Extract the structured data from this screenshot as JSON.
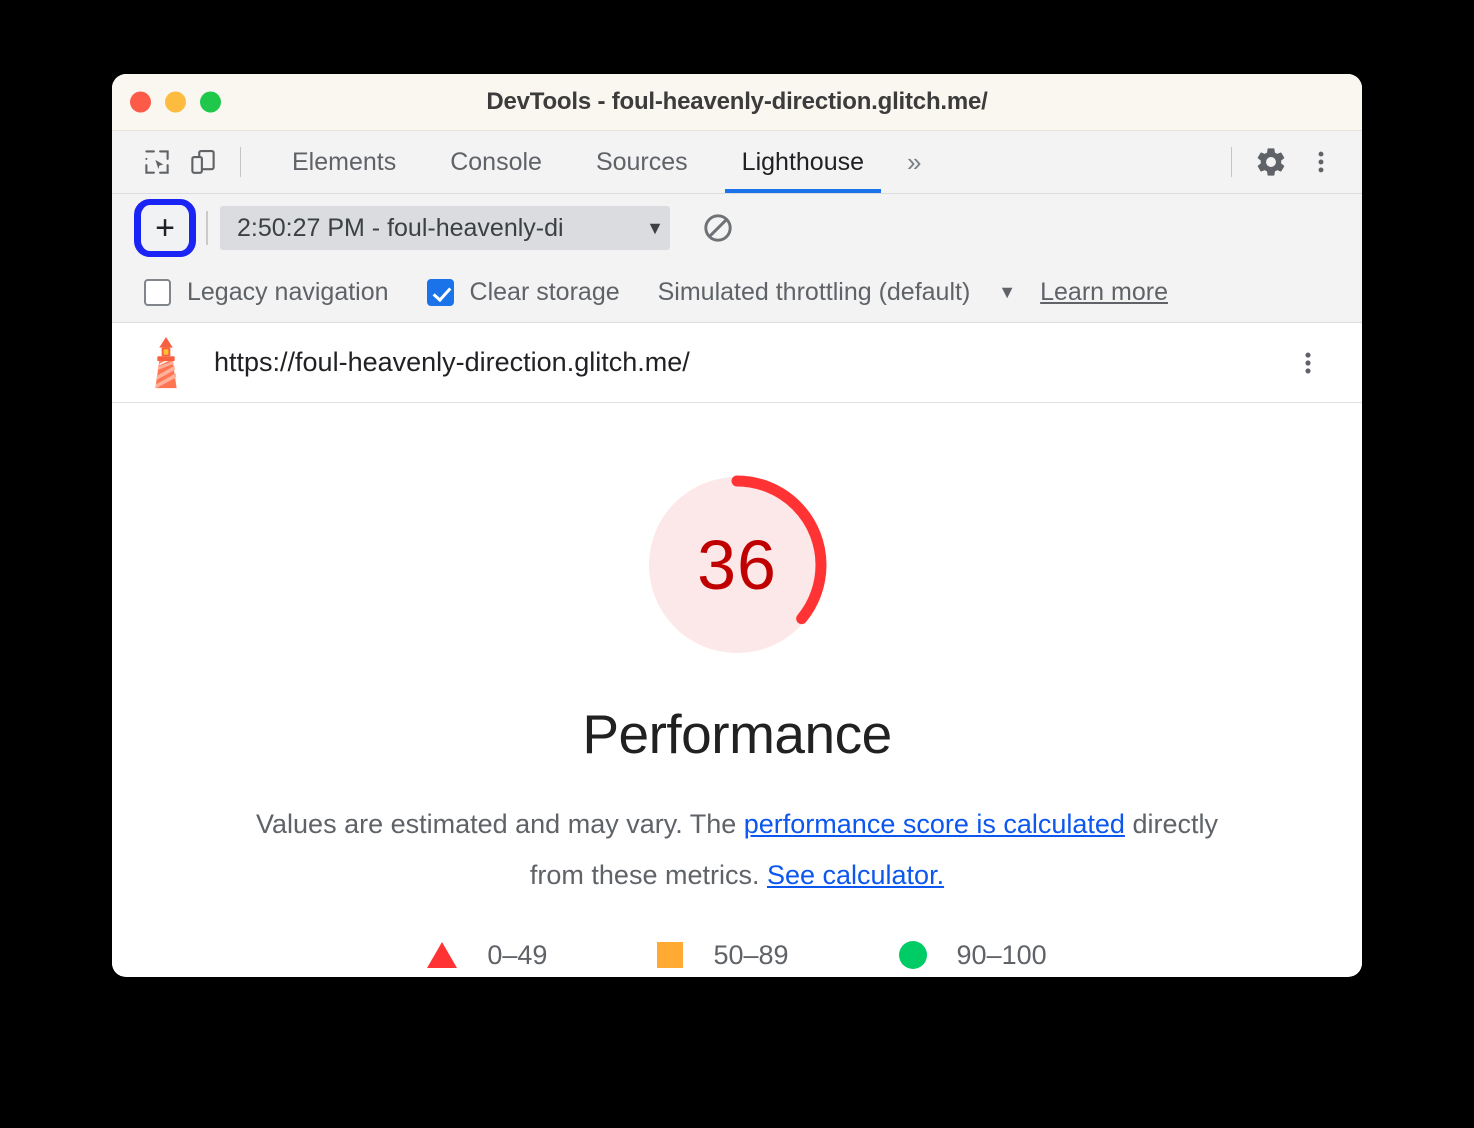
{
  "window": {
    "title": "DevTools - foul-heavenly-direction.glitch.me/",
    "traffic_lights": [
      "close",
      "minimize",
      "maximize"
    ]
  },
  "tabbar": {
    "inspect_icon": "inspect-element-icon",
    "device_icon": "device-toolbar-icon",
    "tabs": [
      {
        "label": "Elements",
        "active": false
      },
      {
        "label": "Console",
        "active": false
      },
      {
        "label": "Sources",
        "active": false
      },
      {
        "label": "Lighthouse",
        "active": true
      }
    ],
    "overflow_label": "»",
    "settings_icon": "gear-icon",
    "more_icon": "kebab-menu-icon"
  },
  "lighthouse_toolbar": {
    "new_report_label": "+",
    "report_select_value": "2:50:27 PM - foul-heavenly-di",
    "report_select_arrow": "▼",
    "clear_icon": "clear-all-icon"
  },
  "options": {
    "legacy_navigation": {
      "label": "Legacy navigation",
      "checked": false
    },
    "clear_storage": {
      "label": "Clear storage",
      "checked": true
    },
    "throttling": {
      "label": "Simulated throttling (default)",
      "arrow": "▼"
    },
    "learn_more": "Learn more"
  },
  "report_header": {
    "logo": "lighthouse-icon",
    "url": "https://foul-heavenly-direction.glitch.me/",
    "more_icon": "kebab-menu-icon"
  },
  "report": {
    "score": "36",
    "category": "Performance",
    "description_part1": "Values are estimated and may vary. The ",
    "description_link1": "performance score is calculated",
    "description_part2": " directly from these metrics. ",
    "description_link2": "See calculator.",
    "legend": [
      {
        "shape": "triangle",
        "range": "0–49",
        "color": "#ff3333"
      },
      {
        "shape": "square",
        "range": "50–89",
        "color": "#ffaa33"
      },
      {
        "shape": "circle",
        "range": "90–100",
        "color": "#00cc66"
      }
    ]
  },
  "chart_data": {
    "type": "pie",
    "title": "Performance",
    "categories": [
      "score",
      "remaining"
    ],
    "values": [
      36,
      64
    ],
    "labels": [
      "36",
      ""
    ],
    "colors": [
      "#f33",
      "#fce8e8"
    ],
    "annotations": [
      "Values are estimated and may vary."
    ],
    "legend": [
      "0–49",
      "50–89",
      "90–100"
    ],
    "legend_position": "bottom",
    "ylim": [
      0,
      100
    ]
  },
  "colors": {
    "accent": "#1a73e8",
    "focus_ring": "#1a25f5",
    "score_red": "#ff3333",
    "score_red_dark": "#c00000",
    "gauge_bg": "#fce8e8",
    "link": "#0b57f0"
  }
}
